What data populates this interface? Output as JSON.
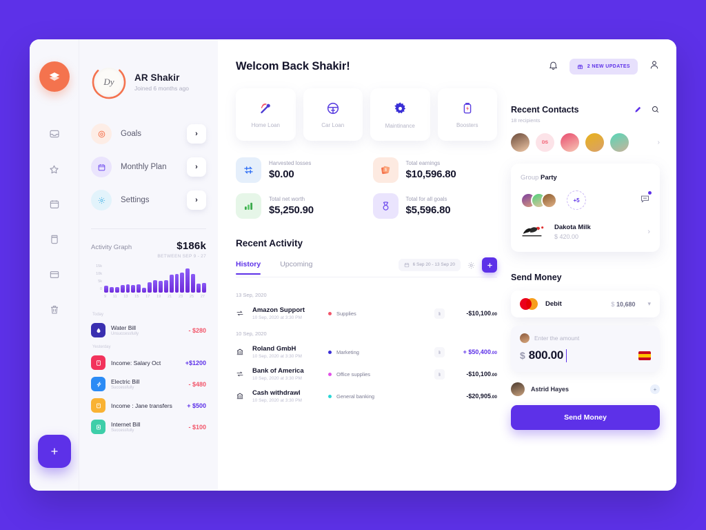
{
  "brand": {
    "logo_icon": "swap-logo-icon",
    "accent": "#5D31E8",
    "logo_color": "#F4734E"
  },
  "rail": {
    "items": [
      {
        "icon": "inbox-icon"
      },
      {
        "icon": "star-icon"
      },
      {
        "icon": "calendar-icon"
      },
      {
        "icon": "jar-icon"
      },
      {
        "icon": "box-icon"
      },
      {
        "icon": "trash-icon"
      }
    ],
    "fab_icon": "plus-icon"
  },
  "profile": {
    "monogram": "Dy",
    "name": "AR Shakir",
    "joined": "Joined 6 months ago"
  },
  "menu": {
    "items": [
      {
        "label": "Goals",
        "icon": "target-icon",
        "color": "#F4734E",
        "bg": "#FDEDE6"
      },
      {
        "label": "Monthly Plan",
        "icon": "calendar-icon",
        "color": "#6D4AEE",
        "bg": "#EAE4FD"
      },
      {
        "label": "Settings",
        "icon": "gear-icon",
        "color": "#4FB8E8",
        "bg": "#E2F3FB"
      }
    ],
    "arrow_icon": "chevron-right-icon"
  },
  "chart_data": {
    "type": "bar",
    "title": "Activity Graph",
    "total": "$186k",
    "range_label": "BETWEEN SEP 9 - 27",
    "xlabel": "",
    "ylabel": "",
    "ylim": [
      0,
      15000
    ],
    "ytick_labels": [
      "15k",
      "10k",
      "5k",
      "0"
    ],
    "grid": false,
    "categories": [
      9,
      10,
      11,
      12,
      13,
      14,
      15,
      16,
      17,
      18,
      19,
      20,
      21,
      22,
      23,
      24,
      25,
      26,
      27
    ],
    "xtick_labels": [
      "9",
      "11",
      "13",
      "15",
      "17",
      "19",
      "21",
      "23",
      "25",
      "27"
    ],
    "values": [
      3600,
      2900,
      3000,
      3800,
      4200,
      4000,
      4300,
      2400,
      5200,
      6400,
      6100,
      6600,
      9200,
      9800,
      10400,
      12400,
      9700,
      4600,
      5000
    ]
  },
  "transactions": {
    "groups": [
      {
        "label": "Today",
        "rows": [
          {
            "name": "Water Bill",
            "status": "Unsuccessfully",
            "amount": "- $280",
            "sign": "neg",
            "icon": "water-drop-icon",
            "color": "#3A2FB0"
          }
        ]
      },
      {
        "label": "Yesterday",
        "rows": [
          {
            "name": "Income: Salary Oct",
            "status": "",
            "amount": "+$1200",
            "sign": "pos",
            "icon": "card-icon",
            "color": "#F2335C"
          },
          {
            "name": "Electric Bill",
            "status": "Successfully",
            "amount": "- $480",
            "sign": "neg",
            "icon": "bolt-icon",
            "color": "#2B8BF5"
          },
          {
            "name": "Income : Jane transfers",
            "status": "",
            "amount": "+ $500",
            "sign": "pos",
            "icon": "wallet-icon",
            "color": "#F9B233"
          },
          {
            "name": "Internet Bill",
            "status": "Successfully",
            "amount": "- $100",
            "sign": "neg",
            "icon": "wifi-icon",
            "color": "#3ECEA9"
          }
        ]
      }
    ]
  },
  "header": {
    "welcome": "Welcom Back Shakir!",
    "bell_icon": "bell-icon",
    "updates_icon": "gift-icon",
    "updates_label": "2 NEW UPDATES",
    "account_icon": "user-icon"
  },
  "quick_cards": [
    {
      "label": "Home Loan",
      "icon": "home-loan-icon"
    },
    {
      "label": "Car Loan",
      "icon": "steering-wheel-icon"
    },
    {
      "label": "Maintinance",
      "icon": "gear-icon"
    },
    {
      "label": "Boosters",
      "icon": "battery-bolt-icon"
    }
  ],
  "stats": [
    {
      "label": "Harvested losses",
      "value": "$0.00",
      "icon": "transfer-icon",
      "bg": "#E5EFFB",
      "color": "#2B6CF5"
    },
    {
      "label": "Total earnings",
      "value": "$10,596.80",
      "icon": "money-icon",
      "bg": "#FDEAE1",
      "color": "#F4734E"
    },
    {
      "label": "Total net worth",
      "value": "$5,250.90",
      "icon": "bar-chart-icon",
      "bg": "#E6F6E8",
      "color": "#3BAA4C"
    },
    {
      "label": "Total for all goals",
      "value": "$5,596.80",
      "icon": "medal-icon",
      "bg": "#EAE4FD",
      "color": "#6D4AEE"
    }
  ],
  "recent_activity": {
    "title": "Recent Activity",
    "tabs": [
      {
        "label": "History",
        "active": true
      },
      {
        "label": "Upcoming",
        "active": false
      }
    ],
    "date_range": "6 Sep 20 - 13 Sep 20",
    "calendar_icon": "calendar-icon",
    "gear_icon": "gear-icon",
    "add_icon": "plus-icon",
    "groups": [
      {
        "date": "13 Sep, 2020",
        "rows": [
          {
            "title": "Amazon Support",
            "time": "10 Sep, 2020 at 3:30 PM",
            "category": "Supplies",
            "dot": "#F2566A",
            "amount": "-$10,100",
            "cents": ".00",
            "sign": "neg",
            "icon": "transfer-icon",
            "clip_icon": "clip-icon"
          }
        ]
      },
      {
        "date": "10 Sep, 2020",
        "rows": [
          {
            "title": "Roland GmbH",
            "time": "10 Sep, 2020 at 3:30 PM",
            "category": "Marketing",
            "dot": "#3B2FD6",
            "amount": "+ $50,400",
            "cents": ".00",
            "sign": "pos",
            "icon": "bank-icon",
            "clip_icon": "clip-icon"
          },
          {
            "title": "Bank of America",
            "time": "10 Sep, 2020 at 3:30 PM",
            "category": "Office supplies",
            "dot": "#E152E8",
            "amount": "-$10,100",
            "cents": ".00",
            "sign": "neg",
            "icon": "transfer-icon",
            "clip_icon": "clip-icon"
          },
          {
            "title": "Cash withdrawl",
            "time": "10 Sep, 2020 at 3:30 PM",
            "category": "General banking",
            "dot": "#2BD6D6",
            "amount": "-$20,905",
            "cents": ".00",
            "sign": "neg",
            "icon": "bank-icon",
            "clip_icon": ""
          }
        ]
      }
    ]
  },
  "contacts": {
    "title": "Recent Contacts",
    "subtitle": "18 recipients",
    "edit_icon": "pencil-icon",
    "search_icon": "search-icon",
    "next_icon": "chevron-right-icon",
    "avatars": [
      {
        "type": "photo",
        "c1": "#6A4A3A",
        "c2": "#F0C9A8",
        "selected": false
      },
      {
        "type": "initials",
        "initials": "DS",
        "selected": false
      },
      {
        "type": "photo",
        "c1": "#E84B6E",
        "c2": "#F7C9B6",
        "selected": true
      },
      {
        "type": "photo",
        "c1": "#E8B21B",
        "c2": "#D9A06A",
        "selected": false
      },
      {
        "type": "photo",
        "c1": "#56D6B8",
        "c2": "#C9B39A",
        "selected": false
      }
    ]
  },
  "group": {
    "prefix": "Group",
    "name": "Party",
    "members": [
      {
        "c1": "#7B3FA0",
        "c2": "#D89A7A"
      },
      {
        "c1": "#4CD07A",
        "c2": "#E8C3A0"
      },
      {
        "c1": "#8B5A2B",
        "c2": "#E0B187"
      }
    ],
    "more_count": "+5",
    "chat_icon": "chat-icon",
    "contact": {
      "logo_icon": "brush-logo-icon",
      "name": "Dakota Milk",
      "amount": "$ 420.00",
      "chevron_icon": "chevron-right-icon"
    }
  },
  "send_money": {
    "title": "Send Money",
    "card": {
      "brand_icon": "mastercard-icon",
      "label": "Debit",
      "currency": "$",
      "balance": "10,680",
      "chevron_icon": "chevron-down-icon"
    },
    "amount": {
      "avatar_icon": "avatar-icon",
      "placeholder": "Enter the amount",
      "currency": "$",
      "value": "800.00",
      "flag_icon": "spain-flag-icon"
    },
    "recipient": {
      "name": "Astrid Hayes",
      "add_icon": "plus-icon"
    },
    "button_label": "Send Money"
  }
}
